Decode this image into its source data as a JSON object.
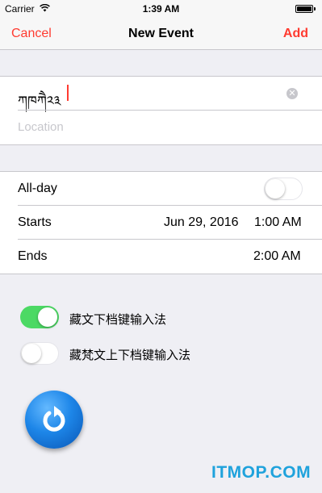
{
  "status_bar": {
    "carrier": "Carrier",
    "time": "1:39 AM"
  },
  "navbar": {
    "cancel": "Cancel",
    "title": "New Event",
    "add": "Add"
  },
  "event": {
    "title_value": "ཀཁཀཻ༢༣",
    "location_placeholder": "Location"
  },
  "schedule": {
    "all_day_label": "All-day",
    "all_day_on": false,
    "starts_label": "Starts",
    "starts_date": "Jun 29, 2016",
    "starts_time": "1:00 AM",
    "ends_label": "Ends",
    "ends_time": "2:00 AM"
  },
  "ime_options": [
    {
      "label": "藏文下档键输入法",
      "on": true
    },
    {
      "label": "藏梵文上下档键输入法",
      "on": false
    }
  ],
  "colors": {
    "accent": "#ff3b30",
    "toggle_on": "#4cd964",
    "refresh_blue": "#1d86e8"
  },
  "icons": [
    "wifi-icon",
    "battery-icon",
    "clear-icon",
    "refresh-icon"
  ],
  "watermark": "ITMOP.COM"
}
